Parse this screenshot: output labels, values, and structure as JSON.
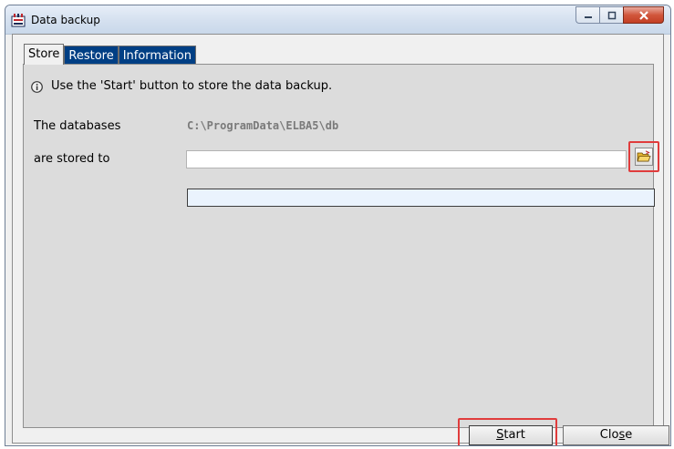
{
  "window": {
    "title": "Data backup",
    "controls": [
      "minimize",
      "maximize",
      "close"
    ]
  },
  "tabs": [
    {
      "label": "Store",
      "active": true
    },
    {
      "label": "Restore",
      "active": false
    },
    {
      "label": "Information",
      "active": false
    }
  ],
  "panel": {
    "info_text": "Use the 'Start' button to store the data backup.",
    "databases_label": "The databases",
    "databases_path": "C:\\ProgramData\\ELBA5\\db",
    "stored_to_label": "are stored to",
    "stored_to_value": "",
    "progress": 0
  },
  "buttons": {
    "start_prefix": "",
    "start_accel": "S",
    "start_rest": "tart",
    "close_prefix": "Clo",
    "close_accel": "s",
    "close_rest": "e"
  },
  "icons": {
    "app": "app-icon",
    "info": "info-icon",
    "browse": "folder-open-icon"
  },
  "colors": {
    "tab_inactive_bg": "#003f84",
    "highlight": "#e03c3c",
    "progress_bg": "#eaf3fd"
  }
}
